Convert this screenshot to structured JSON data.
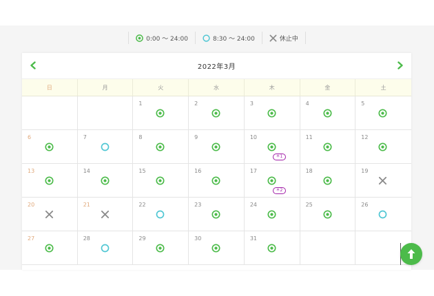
{
  "legend": [
    {
      "icon": "double-circle-icon",
      "label": "0:00 ～ 24:00"
    },
    {
      "icon": "circle-icon",
      "label": "8:30 ～ 24:00"
    },
    {
      "icon": "cross-icon",
      "label": "休止中"
    }
  ],
  "calendar": {
    "title": "2022年3月",
    "weekdays": [
      "日",
      "月",
      "火",
      "水",
      "木",
      "金",
      "土"
    ],
    "days": [
      {
        "day": "",
        "status": "",
        "holiday": false,
        "note": ""
      },
      {
        "day": "",
        "status": "",
        "holiday": false,
        "note": ""
      },
      {
        "day": "1",
        "status": "double",
        "holiday": false,
        "note": ""
      },
      {
        "day": "2",
        "status": "double",
        "holiday": false,
        "note": ""
      },
      {
        "day": "3",
        "status": "double",
        "holiday": false,
        "note": ""
      },
      {
        "day": "4",
        "status": "double",
        "holiday": false,
        "note": ""
      },
      {
        "day": "5",
        "status": "double",
        "holiday": false,
        "note": ""
      },
      {
        "day": "6",
        "status": "double",
        "holiday": true,
        "note": ""
      },
      {
        "day": "7",
        "status": "circle",
        "holiday": false,
        "note": ""
      },
      {
        "day": "8",
        "status": "double",
        "holiday": false,
        "note": ""
      },
      {
        "day": "9",
        "status": "double",
        "holiday": false,
        "note": ""
      },
      {
        "day": "10",
        "status": "double",
        "holiday": false,
        "note": "＊1"
      },
      {
        "day": "11",
        "status": "double",
        "holiday": false,
        "note": ""
      },
      {
        "day": "12",
        "status": "double",
        "holiday": false,
        "note": ""
      },
      {
        "day": "13",
        "status": "double",
        "holiday": true,
        "note": ""
      },
      {
        "day": "14",
        "status": "double",
        "holiday": false,
        "note": ""
      },
      {
        "day": "15",
        "status": "double",
        "holiday": false,
        "note": ""
      },
      {
        "day": "16",
        "status": "double",
        "holiday": false,
        "note": ""
      },
      {
        "day": "17",
        "status": "double",
        "holiday": false,
        "note": "＊2"
      },
      {
        "day": "18",
        "status": "double",
        "holiday": false,
        "note": ""
      },
      {
        "day": "19",
        "status": "cross",
        "holiday": false,
        "note": ""
      },
      {
        "day": "20",
        "status": "cross",
        "holiday": true,
        "note": ""
      },
      {
        "day": "21",
        "status": "cross",
        "holiday": true,
        "note": ""
      },
      {
        "day": "22",
        "status": "circle",
        "holiday": false,
        "note": ""
      },
      {
        "day": "23",
        "status": "double",
        "holiday": false,
        "note": ""
      },
      {
        "day": "24",
        "status": "double",
        "holiday": false,
        "note": ""
      },
      {
        "day": "25",
        "status": "double",
        "holiday": false,
        "note": ""
      },
      {
        "day": "26",
        "status": "circle",
        "holiday": false,
        "note": ""
      },
      {
        "day": "27",
        "status": "double",
        "holiday": true,
        "note": ""
      },
      {
        "day": "28",
        "status": "circle",
        "holiday": false,
        "note": ""
      },
      {
        "day": "29",
        "status": "double",
        "holiday": false,
        "note": ""
      },
      {
        "day": "30",
        "status": "double",
        "holiday": false,
        "note": ""
      },
      {
        "day": "31",
        "status": "double",
        "holiday": false,
        "note": ""
      },
      {
        "day": "",
        "status": "",
        "holiday": false,
        "note": ""
      },
      {
        "day": "",
        "status": "",
        "holiday": false,
        "note": ""
      }
    ]
  },
  "colors": {
    "green": "#4cbb4a",
    "blue": "#4ec6d3",
    "gray": "#8a8a8a",
    "holiday": "#e0a87a",
    "note": "#a11fa8"
  }
}
